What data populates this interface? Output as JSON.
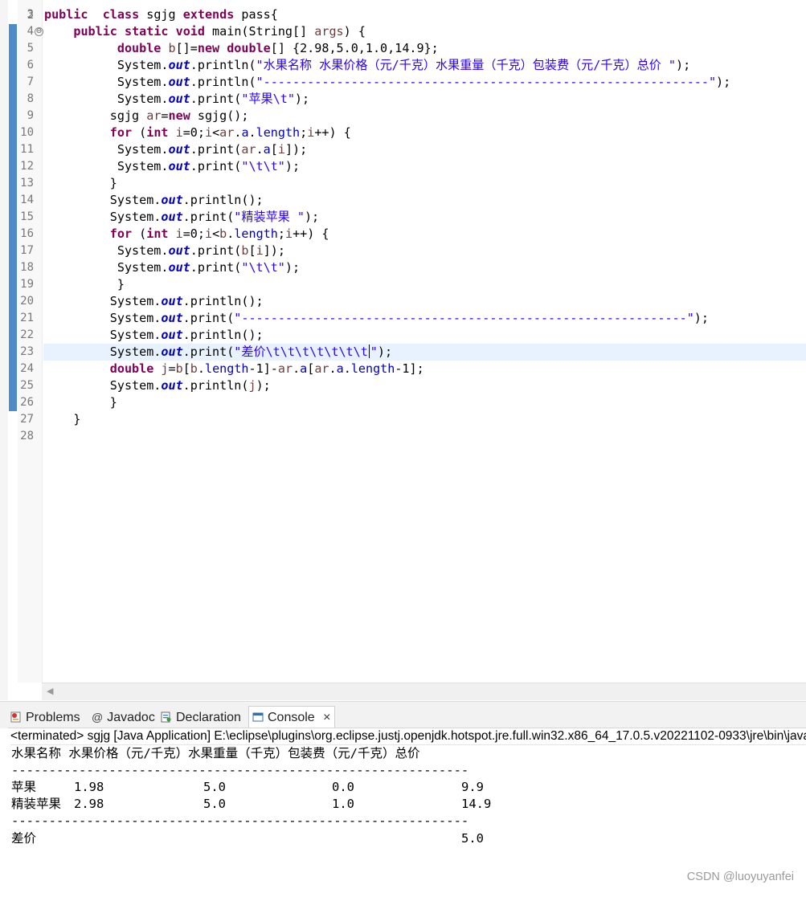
{
  "editor": {
    "partial_top_line_number": "2",
    "lines": [
      {
        "n": "3",
        "segs": [
          [
            "kw",
            "public"
          ],
          [
            "",
            "  "
          ],
          [
            "kw",
            "class"
          ],
          [
            "",
            " sgjg "
          ],
          [
            "kw",
            "extends"
          ],
          [
            "",
            " pass{"
          ]
        ]
      },
      {
        "n": "4",
        "fold": "⊖",
        "segs": [
          [
            "",
            "    "
          ],
          [
            "kw",
            "public"
          ],
          [
            "",
            " "
          ],
          [
            "kw",
            "static"
          ],
          [
            "",
            " "
          ],
          [
            "kw",
            "void"
          ],
          [
            "",
            " main(String[] "
          ],
          [
            "vr",
            "args"
          ],
          [
            "",
            ") {"
          ]
        ]
      },
      {
        "n": "5",
        "segs": [
          [
            "",
            "          "
          ],
          [
            "kw",
            "double"
          ],
          [
            "",
            " "
          ],
          [
            "vr",
            "b"
          ],
          [
            "",
            "[]="
          ],
          [
            "kw",
            "new"
          ],
          [
            "",
            " "
          ],
          [
            "kw",
            "double"
          ],
          [
            "",
            "[] {2.98,5.0,1.0,14.9};"
          ]
        ]
      },
      {
        "n": "6",
        "segs": [
          [
            "",
            "          System."
          ],
          [
            "fd",
            "out"
          ],
          [
            "",
            ".println("
          ],
          [
            "st",
            "\"水果名称 水果价格（元/千克）水果重量（千克）包装费（元/千克）总价 \""
          ],
          [
            "",
            ");"
          ]
        ]
      },
      {
        "n": "7",
        "segs": [
          [
            "",
            "          System."
          ],
          [
            "fd",
            "out"
          ],
          [
            "",
            ".println("
          ],
          [
            "st",
            "\"-------------------------------------------------------------\""
          ],
          [
            "",
            ");"
          ]
        ]
      },
      {
        "n": "8",
        "segs": [
          [
            "",
            "          System."
          ],
          [
            "fd",
            "out"
          ],
          [
            "",
            ".print("
          ],
          [
            "st",
            "\"苹果\\t\""
          ],
          [
            "",
            ");"
          ]
        ]
      },
      {
        "n": "9",
        "segs": [
          [
            "",
            "         sgjg "
          ],
          [
            "vr",
            "ar"
          ],
          [
            "",
            "="
          ],
          [
            "kw",
            "new"
          ],
          [
            "",
            " sgjg();"
          ]
        ]
      },
      {
        "n": "10",
        "segs": [
          [
            "",
            "         "
          ],
          [
            "kw",
            "for"
          ],
          [
            "",
            " ("
          ],
          [
            "kw",
            "int"
          ],
          [
            "",
            " "
          ],
          [
            "vr",
            "i"
          ],
          [
            "",
            "=0;"
          ],
          [
            "vr",
            "i"
          ],
          [
            "",
            "<"
          ],
          [
            "vr",
            "ar"
          ],
          [
            "",
            "."
          ],
          [
            "ar",
            "a"
          ],
          [
            "",
            "."
          ],
          [
            "ar",
            "length"
          ],
          [
            "",
            ";"
          ],
          [
            "vr",
            "i"
          ],
          [
            "",
            "++) {"
          ]
        ]
      },
      {
        "n": "11",
        "segs": [
          [
            "",
            "          System."
          ],
          [
            "fd",
            "out"
          ],
          [
            "",
            ".print("
          ],
          [
            "vr",
            "ar"
          ],
          [
            "",
            "."
          ],
          [
            "ar",
            "a"
          ],
          [
            "",
            "["
          ],
          [
            "vr",
            "i"
          ],
          [
            "",
            "]);"
          ]
        ]
      },
      {
        "n": "12",
        "segs": [
          [
            "",
            "          System."
          ],
          [
            "fd",
            "out"
          ],
          [
            "",
            ".print("
          ],
          [
            "st",
            "\"\\t\\t\""
          ],
          [
            "",
            ");"
          ]
        ]
      },
      {
        "n": "13",
        "segs": [
          [
            "",
            "         }"
          ]
        ]
      },
      {
        "n": "14",
        "segs": [
          [
            "",
            "         System."
          ],
          [
            "fd",
            "out"
          ],
          [
            "",
            ".println();"
          ]
        ]
      },
      {
        "n": "15",
        "segs": [
          [
            "",
            "         System."
          ],
          [
            "fd",
            "out"
          ],
          [
            "",
            ".print("
          ],
          [
            "st",
            "\"精装苹果 \""
          ],
          [
            "",
            ");"
          ]
        ]
      },
      {
        "n": "16",
        "segs": [
          [
            "",
            "         "
          ],
          [
            "kw",
            "for"
          ],
          [
            "",
            " ("
          ],
          [
            "kw",
            "int"
          ],
          [
            "",
            " "
          ],
          [
            "vr",
            "i"
          ],
          [
            "",
            "=0;"
          ],
          [
            "vr",
            "i"
          ],
          [
            "",
            "<"
          ],
          [
            "vr",
            "b"
          ],
          [
            "",
            "."
          ],
          [
            "ar",
            "length"
          ],
          [
            "",
            ";"
          ],
          [
            "vr",
            "i"
          ],
          [
            "",
            "++) {"
          ]
        ]
      },
      {
        "n": "17",
        "segs": [
          [
            "",
            "          System."
          ],
          [
            "fd",
            "out"
          ],
          [
            "",
            ".print("
          ],
          [
            "vr",
            "b"
          ],
          [
            "",
            "["
          ],
          [
            "vr",
            "i"
          ],
          [
            "",
            "]);"
          ]
        ]
      },
      {
        "n": "18",
        "segs": [
          [
            "",
            "          System."
          ],
          [
            "fd",
            "out"
          ],
          [
            "",
            ".print("
          ],
          [
            "st",
            "\"\\t\\t\""
          ],
          [
            "",
            ");"
          ]
        ]
      },
      {
        "n": "19",
        "segs": [
          [
            "",
            "          }"
          ]
        ]
      },
      {
        "n": "20",
        "segs": [
          [
            "",
            "         System."
          ],
          [
            "fd",
            "out"
          ],
          [
            "",
            ".println();"
          ]
        ]
      },
      {
        "n": "21",
        "segs": [
          [
            "",
            "         System."
          ],
          [
            "fd",
            "out"
          ],
          [
            "",
            ".print("
          ],
          [
            "st",
            "\"-------------------------------------------------------------\""
          ],
          [
            "",
            ");"
          ]
        ]
      },
      {
        "n": "22",
        "segs": [
          [
            "",
            "         System."
          ],
          [
            "fd",
            "out"
          ],
          [
            "",
            ".println();"
          ]
        ]
      },
      {
        "n": "23",
        "highlight": true,
        "segs": [
          [
            "",
            "         System."
          ],
          [
            "fd",
            "out"
          ],
          [
            "",
            ".print("
          ],
          [
            "st",
            "\"差价\\t\\t\\t\\t\\t\\t\\t"
          ],
          [
            "caret",
            ""
          ],
          [
            "st",
            "\""
          ],
          [
            "",
            ");"
          ]
        ]
      },
      {
        "n": "24",
        "segs": [
          [
            "",
            "         "
          ],
          [
            "kw",
            "double"
          ],
          [
            "",
            " "
          ],
          [
            "vr",
            "j"
          ],
          [
            "",
            "="
          ],
          [
            "vr",
            "b"
          ],
          [
            "",
            "["
          ],
          [
            "vr",
            "b"
          ],
          [
            "",
            "."
          ],
          [
            "ar",
            "length"
          ],
          [
            "",
            "-1]-"
          ],
          [
            "vr",
            "ar"
          ],
          [
            "",
            "."
          ],
          [
            "ar",
            "a"
          ],
          [
            "",
            "["
          ],
          [
            "vr",
            "ar"
          ],
          [
            "",
            "."
          ],
          [
            "ar",
            "a"
          ],
          [
            "",
            "."
          ],
          [
            "ar",
            "length"
          ],
          [
            "",
            "-1];"
          ]
        ]
      },
      {
        "n": "25",
        "segs": [
          [
            "",
            "         System."
          ],
          [
            "fd",
            "out"
          ],
          [
            "",
            ".println("
          ],
          [
            "vr",
            "j"
          ],
          [
            "",
            ");"
          ]
        ]
      },
      {
        "n": "26",
        "segs": [
          [
            "",
            "         }"
          ]
        ]
      },
      {
        "n": "27",
        "segs": [
          [
            "",
            "    }"
          ]
        ]
      },
      {
        "n": "28",
        "segs": []
      }
    ]
  },
  "views": {
    "tabs": [
      {
        "id": "problems",
        "label": "Problems",
        "icon": "problems-icon"
      },
      {
        "id": "javadoc",
        "label": "Javadoc",
        "icon": "at-icon",
        "glyph": "@"
      },
      {
        "id": "declaration",
        "label": "Declaration",
        "icon": "declaration-icon"
      },
      {
        "id": "console",
        "label": "Console",
        "icon": "console-icon",
        "active": true,
        "close": "×"
      }
    ]
  },
  "console": {
    "status": "<terminated> sgjg [Java Application] E:\\eclipse\\plugins\\org.eclipse.justj.openjdk.hotspot.jre.full.win32.x86_64_17.0.5.v20221102-0933\\jre\\bin\\javaw.exe",
    "header": "水果名称 水果价格（元/千克）水果重量（千克）包装费（元/千克）总价",
    "separator": "-------------------------------------------------------------",
    "rows": [
      {
        "name": "苹果",
        "values": [
          "1.98",
          "5.0",
          "0.0",
          "9.9"
        ]
      },
      {
        "name": "精装苹果",
        "values": [
          "2.98",
          "5.0",
          "1.0",
          "14.9"
        ]
      }
    ],
    "diff_label": "差价",
    "diff_value": "5.0"
  },
  "watermark": "CSDN @luoyuyanfei"
}
